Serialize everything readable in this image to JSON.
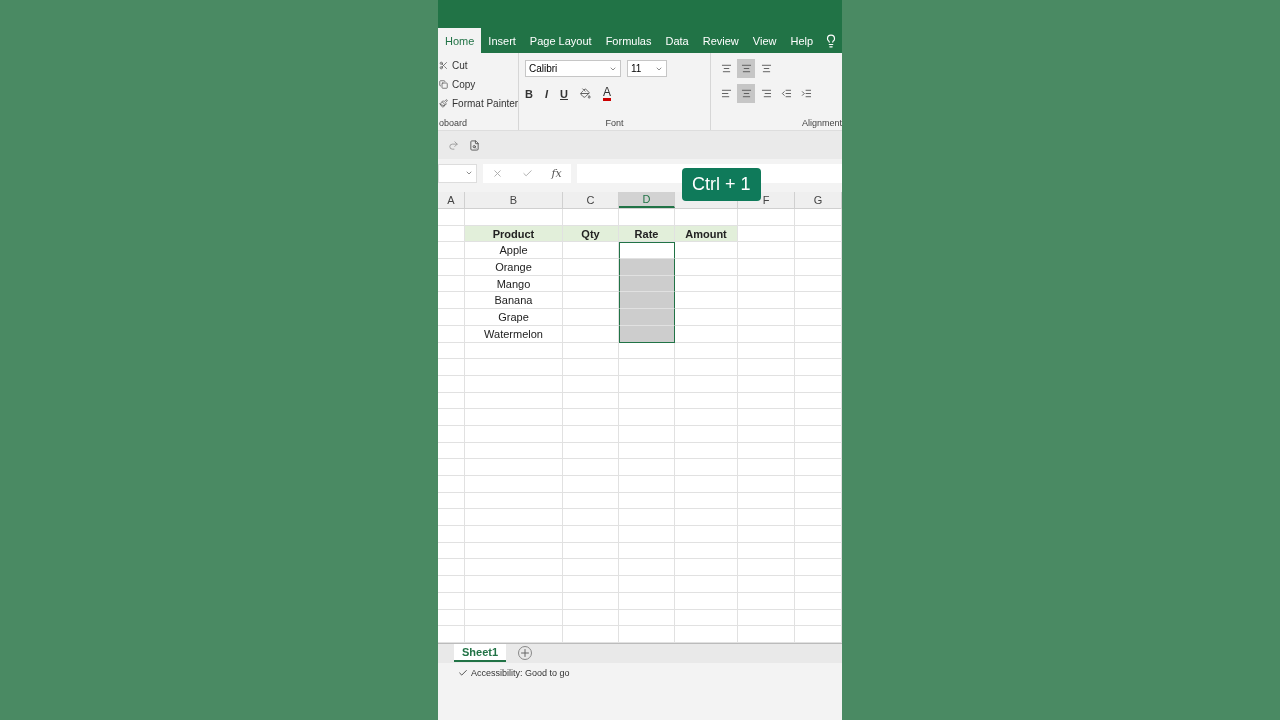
{
  "ribbon_tabs": [
    {
      "label": "Home",
      "selected": true
    },
    {
      "label": "Insert",
      "selected": false
    },
    {
      "label": "Page Layout",
      "selected": false
    },
    {
      "label": "Formulas",
      "selected": false
    },
    {
      "label": "Data",
      "selected": false
    },
    {
      "label": "Review",
      "selected": false
    },
    {
      "label": "View",
      "selected": false
    },
    {
      "label": "Help",
      "selected": false
    }
  ],
  "clipboard": {
    "items": [
      "Cut",
      "Copy",
      "Format Painter"
    ],
    "group_label": "oboard"
  },
  "font": {
    "name": "Calibri",
    "size": "11",
    "bold": "B",
    "italic": "I",
    "underline": "U",
    "color_letter": "A",
    "group_label": "Font"
  },
  "alignment": {
    "group_label": "Alignment"
  },
  "columns": [
    {
      "label": "A",
      "selected": false
    },
    {
      "label": "B",
      "selected": false
    },
    {
      "label": "C",
      "selected": false
    },
    {
      "label": "D",
      "selected": true
    },
    {
      "selected": false
    },
    {
      "label": "F",
      "selected": false
    },
    {
      "label": "G",
      "selected": false
    }
  ],
  "table": {
    "headers": [
      "Product",
      "Qty",
      "Rate",
      "Amount"
    ],
    "rows": [
      {
        "product": "Apple",
        "selected": true,
        "active": true
      },
      {
        "product": "Orange",
        "selected": true,
        "active": false
      },
      {
        "product": "Mango",
        "selected": true,
        "active": false
      },
      {
        "product": "Banana",
        "selected": true,
        "active": false
      },
      {
        "product": "Grape",
        "selected": true,
        "active": false
      },
      {
        "product": "Watermelon",
        "selected": true,
        "active": false
      }
    ]
  },
  "formula_bar": {
    "function_symbol": "fx"
  },
  "shortcut_badge": "Ctrl + 1",
  "sheet_tabs": [
    {
      "label": "Sheet1",
      "selected": true
    }
  ],
  "status_bar": {
    "accessibility": "Accessibility: Good to go"
  }
}
